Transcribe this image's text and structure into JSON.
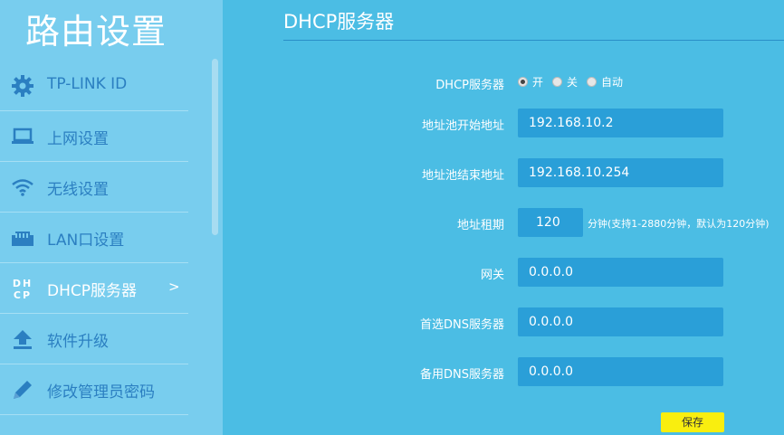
{
  "sidebar": {
    "brand": "路由设置",
    "items": [
      {
        "label": "TP-LINK ID",
        "icon": "gear-icon"
      },
      {
        "label": "上网设置",
        "icon": "laptop-icon"
      },
      {
        "label": "无线设置",
        "icon": "wifi-icon"
      },
      {
        "label": "LAN口设置",
        "icon": "lan-port-icon"
      },
      {
        "label": "DHCP服务器",
        "icon": "dhcp-icon",
        "icon_text": "DHCP",
        "arrow": ">",
        "active": true
      },
      {
        "label": "软件升级",
        "icon": "upload-icon"
      },
      {
        "label": "修改管理员密码",
        "icon": "pencil-icon"
      }
    ]
  },
  "main": {
    "title": "DHCP服务器",
    "dhcp": {
      "label": "DHCP服务器",
      "options": [
        "开",
        "关",
        "自动"
      ],
      "selected": "开"
    },
    "pool_start": {
      "label": "地址池开始地址",
      "value": "192.168.10.2"
    },
    "pool_end": {
      "label": "地址池结束地址",
      "value": "192.168.10.254"
    },
    "lease": {
      "label": "地址租期",
      "value": "120",
      "hint": "分钟(支持1-2880分钟，默认为120分钟)"
    },
    "gateway": {
      "label": "网关",
      "value": "0.0.0.0"
    },
    "dns_primary": {
      "label": "首选DNS服务器",
      "value": "0.0.0.0"
    },
    "dns_backup": {
      "label": "备用DNS服务器",
      "value": "0.0.0.0"
    },
    "save_label": "保存"
  },
  "colors": {
    "main_bg": "#4bbde4",
    "sidebar_bg": "#78cdee",
    "accent_blue": "#2b7fc1",
    "field_bg": "#2a9fd8",
    "save_button": "#f9ee0f"
  }
}
